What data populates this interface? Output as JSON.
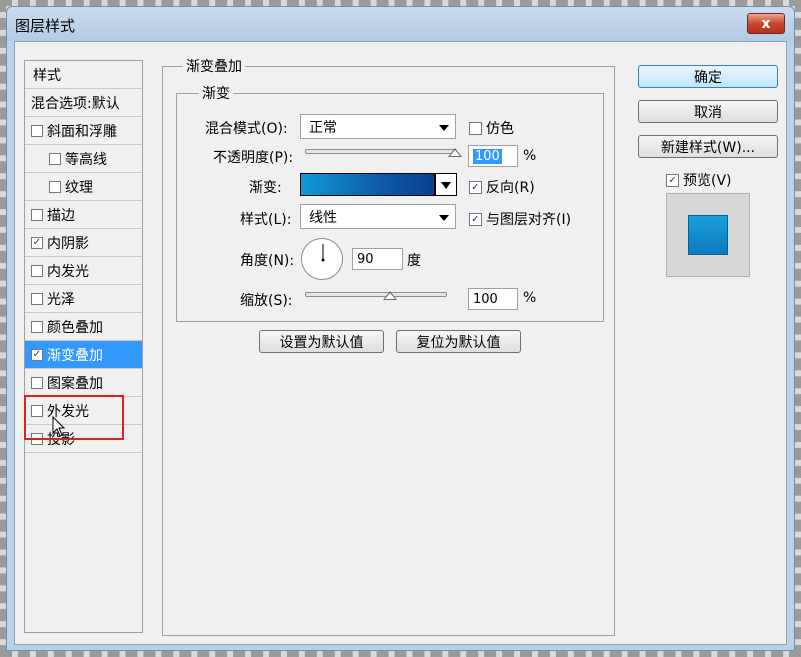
{
  "window": {
    "title": "图层样式",
    "close_label": "x"
  },
  "style_list": {
    "header": "样式",
    "items": [
      {
        "label": "混合选项:默认",
        "checkbox": false,
        "checked": false,
        "indent": false,
        "selected": false
      },
      {
        "label": "斜面和浮雕",
        "checkbox": true,
        "checked": false,
        "indent": false,
        "selected": false
      },
      {
        "label": "等高线",
        "checkbox": true,
        "checked": false,
        "indent": true,
        "selected": false
      },
      {
        "label": "纹理",
        "checkbox": true,
        "checked": false,
        "indent": true,
        "selected": false
      },
      {
        "label": "描边",
        "checkbox": true,
        "checked": false,
        "indent": false,
        "selected": false
      },
      {
        "label": "内阴影",
        "checkbox": true,
        "checked": true,
        "indent": false,
        "selected": false
      },
      {
        "label": "内发光",
        "checkbox": true,
        "checked": false,
        "indent": false,
        "selected": false
      },
      {
        "label": "光泽",
        "checkbox": true,
        "checked": false,
        "indent": false,
        "selected": false
      },
      {
        "label": "颜色叠加",
        "checkbox": true,
        "checked": false,
        "indent": false,
        "selected": false
      },
      {
        "label": "渐变叠加",
        "checkbox": true,
        "checked": true,
        "indent": false,
        "selected": true
      },
      {
        "label": "图案叠加",
        "checkbox": true,
        "checked": false,
        "indent": false,
        "selected": false
      },
      {
        "label": "外发光",
        "checkbox": true,
        "checked": false,
        "indent": false,
        "selected": false
      },
      {
        "label": "投影",
        "checkbox": true,
        "checked": false,
        "indent": false,
        "selected": false
      }
    ]
  },
  "gradient_overlay": {
    "group_title": "渐变叠加",
    "sub_group_title": "渐变",
    "blend_mode": {
      "label": "混合模式(O):",
      "value": "正常"
    },
    "dither": {
      "label": "仿色",
      "checked": false
    },
    "opacity": {
      "label": "不透明度(P):",
      "value": "100",
      "unit": "%",
      "slider_fraction": 1.0
    },
    "gradient": {
      "label": "渐变:",
      "colors": [
        "#0e9ad6",
        "#0e5aa8",
        "#0b3f8e"
      ]
    },
    "reverse": {
      "label": "反向(R)",
      "checked": true
    },
    "style": {
      "label": "样式(L):",
      "value": "线性"
    },
    "align_with_layer": {
      "label": "与图层对齐(I)",
      "checked": true
    },
    "angle": {
      "label": "角度(N):",
      "value": "90",
      "unit": "度"
    },
    "scale": {
      "label": "缩放(S):",
      "value": "100",
      "unit": "%",
      "slider_fraction": 0.6
    },
    "set_default_label": "设置为默认值",
    "reset_default_label": "复位为默认值"
  },
  "buttons": {
    "ok": "确定",
    "cancel": "取消",
    "new_style": "新建样式(W)..."
  },
  "preview": {
    "label": "预览(V)",
    "checked": true,
    "swatch_color": "#1a8fd0"
  },
  "accent_colors": {
    "selection": "#3399ff",
    "highlight_box": "#e02020"
  }
}
